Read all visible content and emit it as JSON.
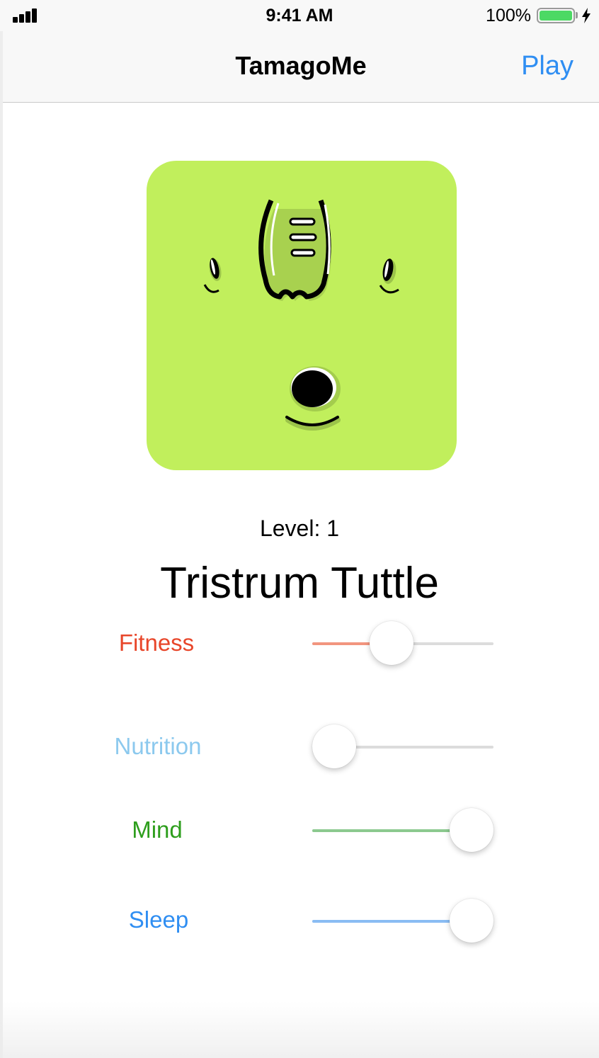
{
  "status_bar": {
    "time": "9:41 AM",
    "battery_percent": "100%",
    "battery_level": 1.0,
    "icons": [
      "signal-icon",
      "battery-icon",
      "charging-bolt-icon"
    ]
  },
  "nav": {
    "title": "TamagoMe",
    "play_label": "Play"
  },
  "pet": {
    "card_color": "#c1ef5c",
    "level_text": "Level: 1",
    "name": "Tristrum Tuttle"
  },
  "stats": [
    {
      "label": "Fitness",
      "color": "#e8462a",
      "fill_color": "#f2957f",
      "value": 0.42
    },
    {
      "label": "Nutrition",
      "color": "#8cc9ee",
      "fill_color": "#8cc9ee",
      "value": 0.0
    },
    {
      "label": "Mind",
      "color": "#2e9e1d",
      "fill_color": "#8cc98f",
      "value": 1.0
    },
    {
      "label": "Sleep",
      "color": "#2f8ef2",
      "fill_color": "#8abcf3",
      "value": 1.0
    }
  ]
}
